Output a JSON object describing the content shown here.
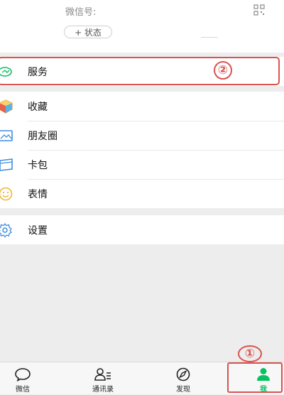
{
  "profile": {
    "wechat_id_label": "微信号:",
    "status_button": "+ 状态"
  },
  "menu": {
    "service": {
      "label": "服务",
      "icon": "service-icon"
    },
    "favorites": {
      "label": "收藏",
      "icon": "favorites-cube-icon"
    },
    "moments": {
      "label": "朋友圈",
      "icon": "moments-photo-icon"
    },
    "card_wallet": {
      "label": "卡包",
      "icon": "card-icon"
    },
    "stickers": {
      "label": "表情",
      "icon": "smiley-icon"
    },
    "settings": {
      "label": "设置",
      "icon": "gear-icon"
    }
  },
  "annotations": {
    "marker_1": "①",
    "marker_2": "②",
    "color": "#d9534f"
  },
  "tabs": [
    {
      "label": "微信",
      "icon": "chat-bubble-icon",
      "active": false
    },
    {
      "label": "通讯录",
      "icon": "contacts-icon",
      "active": false
    },
    {
      "label": "发现",
      "icon": "compass-icon",
      "active": false
    },
    {
      "label": "我",
      "icon": "person-icon",
      "active": true
    }
  ],
  "colors": {
    "accent": "#07c160",
    "background": "#ededed"
  }
}
